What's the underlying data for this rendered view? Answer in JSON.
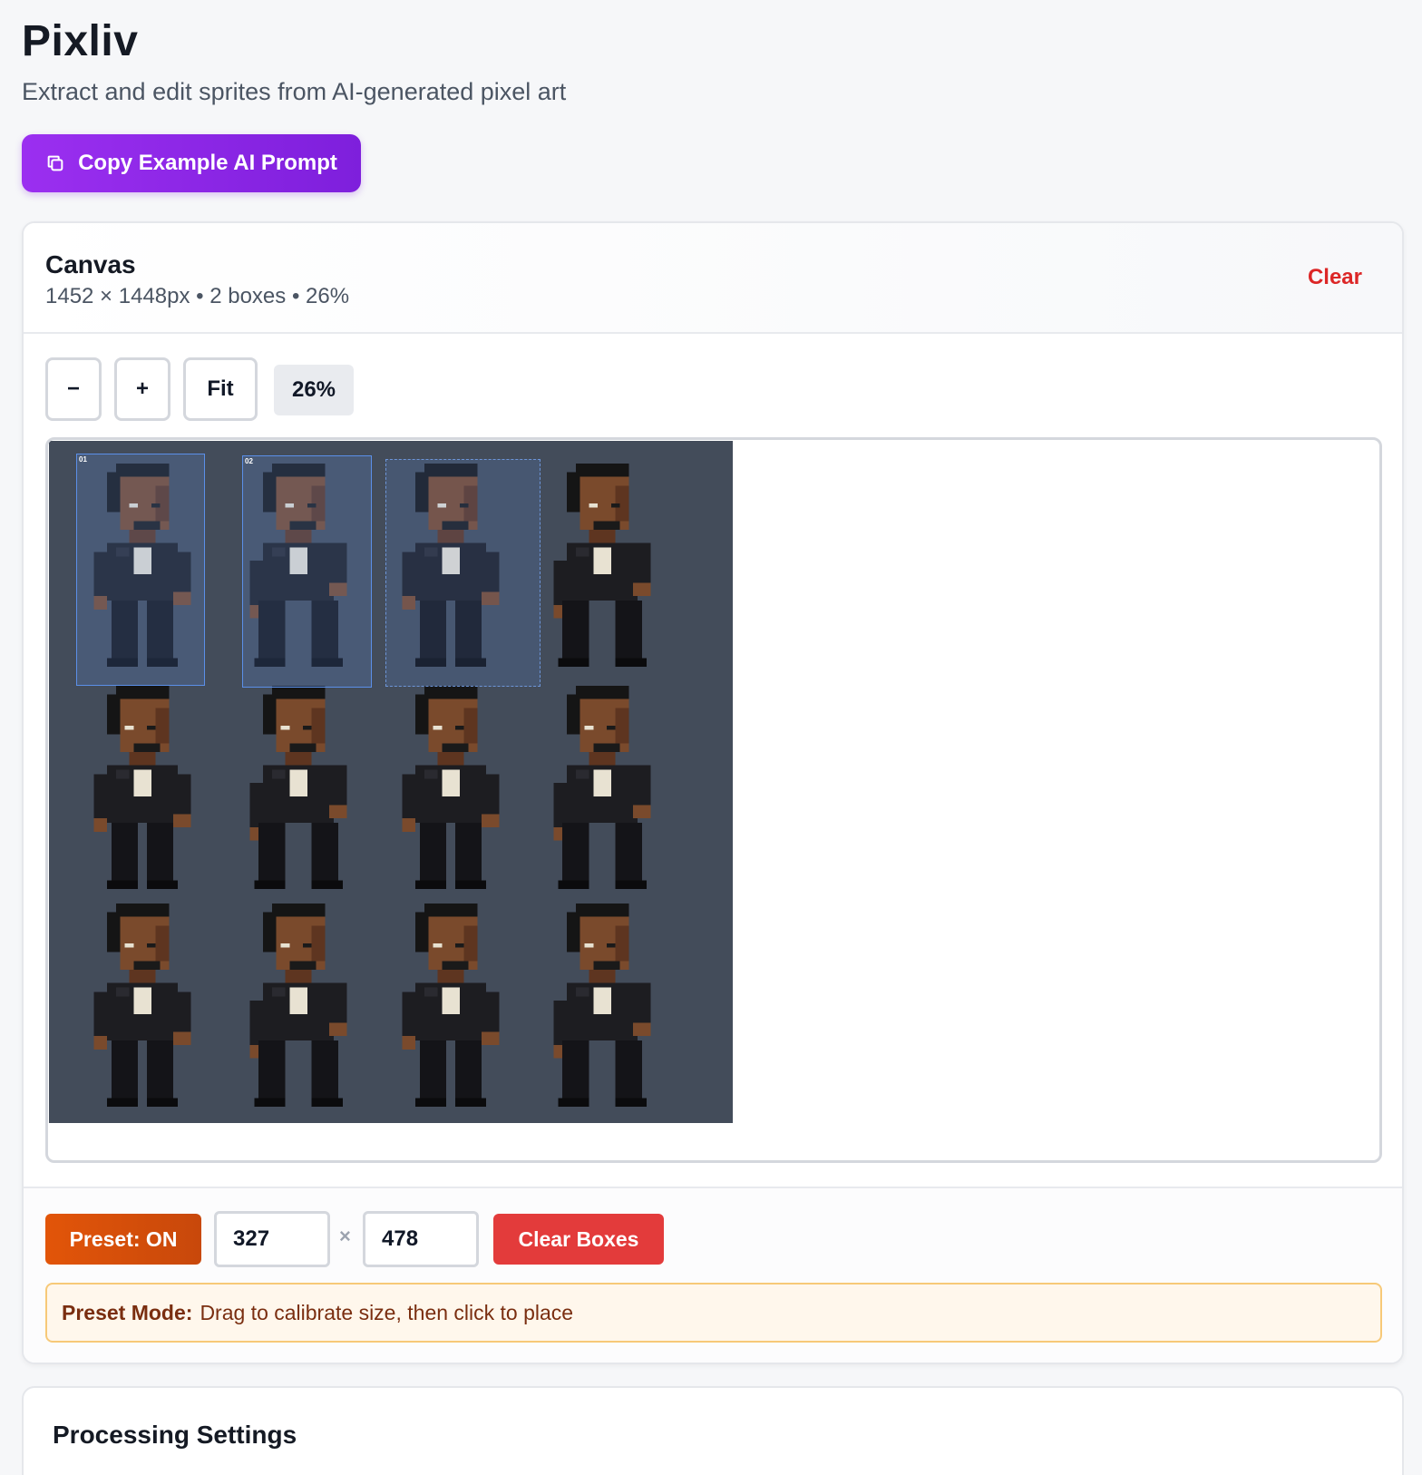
{
  "app": {
    "title": "Pixliv",
    "subtitle": "Extract and edit sprites from AI-generated pixel art",
    "prompt_button_label": "Copy Example AI Prompt"
  },
  "canvas_card": {
    "title": "Canvas",
    "meta": "1452 × 1448px • 2 boxes • 26%",
    "clear_label": "Clear",
    "zoom": {
      "minus_label": "−",
      "plus_label": "+",
      "fit_label": "Fit",
      "level": "26%"
    },
    "box_tags": [
      "01",
      "02"
    ],
    "preset": {
      "toggle_label": "Preset: ON",
      "width": "327",
      "times": "×",
      "height": "478",
      "clear_boxes_label": "Clear Boxes",
      "notice_label": "Preset Mode:",
      "notice_text": "Drag to calibrate size, then click to place"
    }
  },
  "settings_card": {
    "title": "Processing Settings"
  },
  "colors": {
    "accent": "#8b2be6",
    "danger": "#dc2626",
    "preset": "#d9500a",
    "sheet_bg": "#434c5a",
    "selection": "#5b8fe8"
  }
}
